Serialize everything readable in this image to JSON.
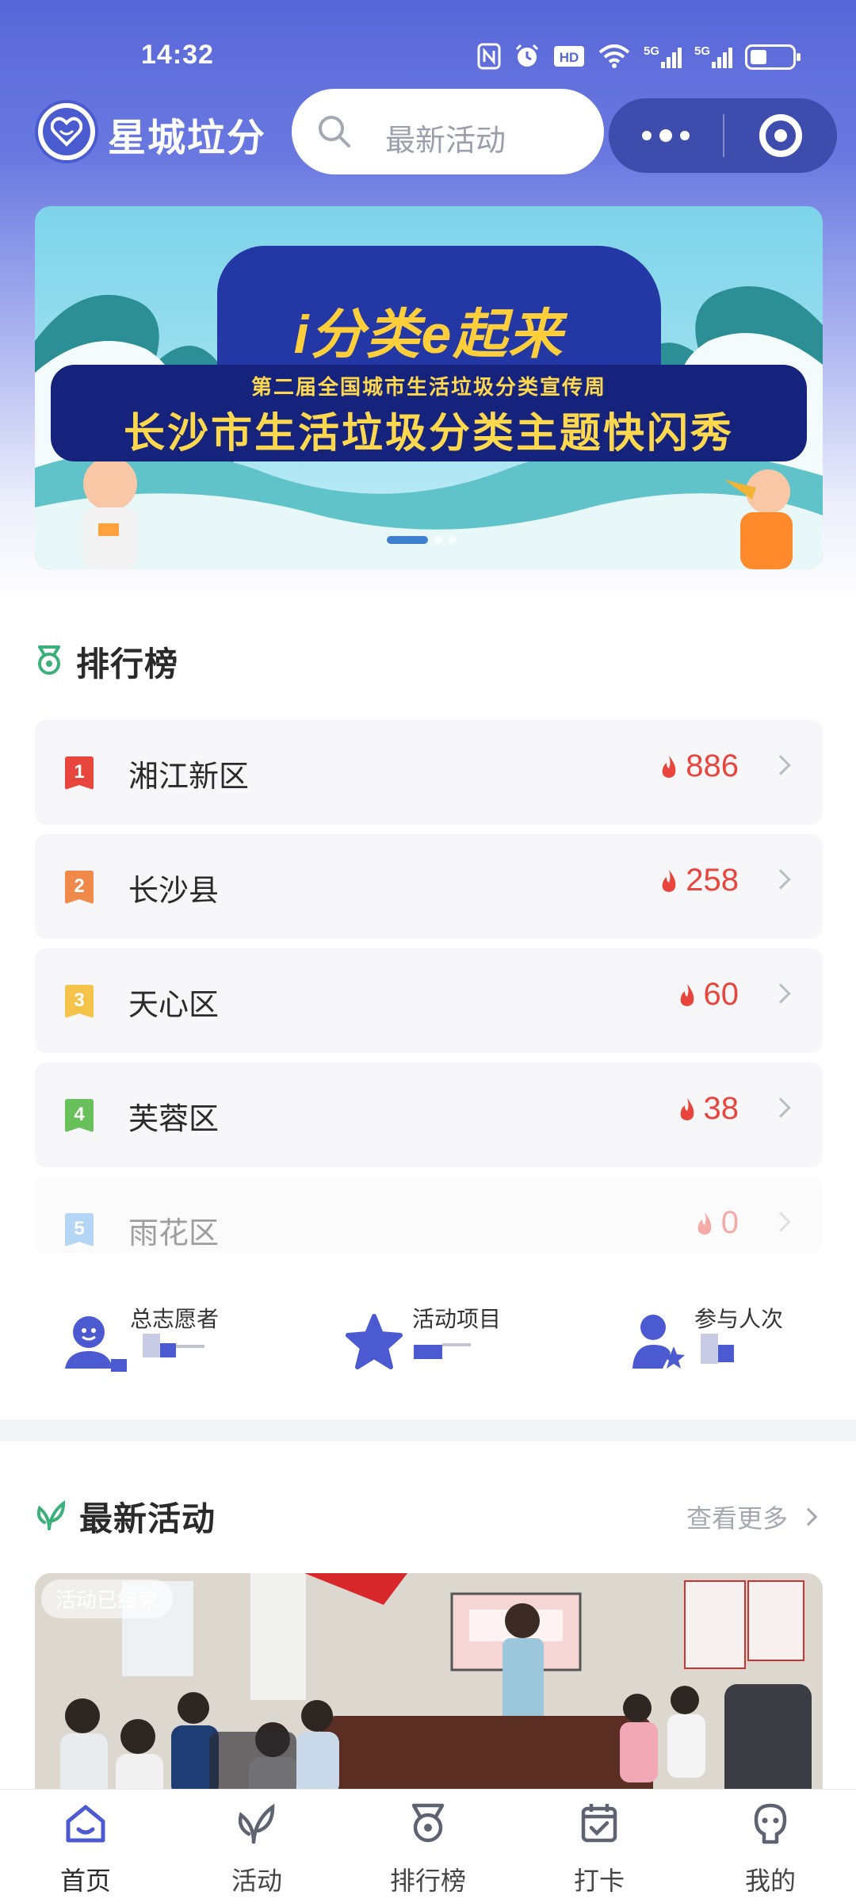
{
  "status_bar": {
    "time": "14:32",
    "icons": [
      "nfc-icon",
      "alarm-icon",
      "hd-icon",
      "wifi-icon",
      "signal-5g-icon",
      "signal-5g-icon",
      "battery-icon"
    ],
    "hd_text": "HD",
    "net1": "5G",
    "net2": "5G"
  },
  "header": {
    "app_title": "星城垃分",
    "search_placeholder": "最新活动"
  },
  "banner": {
    "line1": "i分类e起来",
    "line2": "第二届全国城市生活垃圾分类宣传周",
    "line3": "长沙市生活垃圾分类主题快闪秀",
    "slide_count": 3,
    "active_slide": 1
  },
  "ranking": {
    "title": "排行榜",
    "items": [
      {
        "rank": "1",
        "name": "湘江新区",
        "score": "886",
        "color": "#e8453c"
      },
      {
        "rank": "2",
        "name": "长沙县",
        "score": "258",
        "color": "#f08a4b"
      },
      {
        "rank": "3",
        "name": "天心区",
        "score": "60",
        "color": "#f5c34a"
      },
      {
        "rank": "4",
        "name": "芙蓉区",
        "score": "38",
        "color": "#67c05a"
      },
      {
        "rank": "5",
        "name": "雨花区",
        "score": "0",
        "color": "#5aa3e8"
      }
    ]
  },
  "stats": {
    "volunteers_label": "总志愿者",
    "projects_label": "活动项目",
    "participants_label": "参与人次"
  },
  "latest": {
    "title": "最新活动",
    "more_label": "查看更多",
    "card_status": "活动已结束"
  },
  "tabbar": {
    "items": [
      {
        "label": "首页",
        "icon": "home-icon"
      },
      {
        "label": "活动",
        "icon": "sprout-icon"
      },
      {
        "label": "排行榜",
        "icon": "medal-icon"
      },
      {
        "label": "打卡",
        "icon": "calendar-check-icon"
      },
      {
        "label": "我的",
        "icon": "user-icon"
      }
    ]
  },
  "colors": {
    "primary": "#4a5bd0",
    "header_bg": "#5867d8",
    "score_red": "#e8453c",
    "accent_green": "#3bb07a"
  }
}
